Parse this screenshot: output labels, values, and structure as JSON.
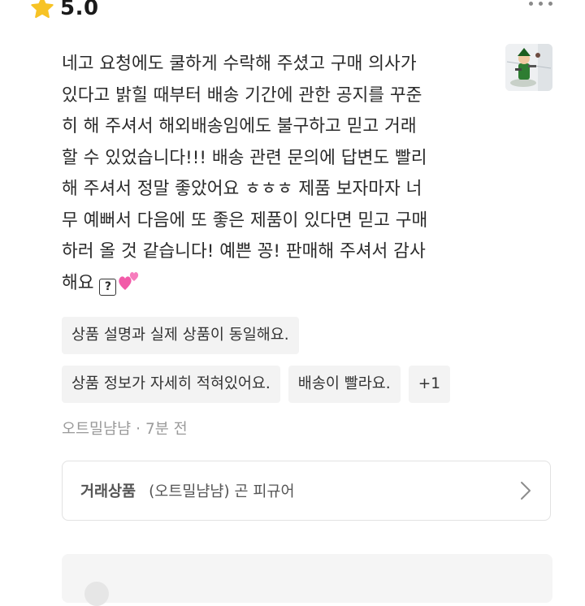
{
  "rating": {
    "value": "5.0",
    "icon": "star-icon",
    "star_color": "#F7C325"
  },
  "more_menu": {
    "icon": "more-dots-icon"
  },
  "review": {
    "lines": [
      "네고 요청에도 쿨하게 수락해 주셨고 구매 의사가",
      "있다고 밝힐 때부터 배송 기간에 관한 공지를 꾸준",
      "히 해 주셔서 해외배송임에도 불구하고 믿고 거래",
      "할 수 있었습니다!!! 배송 관련 문의에 답변도 빨리",
      "해 주셔서 정말 좋았어요 ㅎㅎㅎ 제품 보자마자 너",
      "무 예뻐서 다음에 또 좋은 제품이 있다면 믿고 구매",
      "하러 올 것 같습니다! 예쁜 꽁! 판매해 주셔서 감사"
    ],
    "last_line": "해요 ",
    "question_glyph": "?",
    "heart_icon": "two-hearts-icon",
    "heart_color": "#F25AA8"
  },
  "thumbnail": {
    "icon": "figure-photo"
  },
  "tags": {
    "row1": [
      "상품 설명과 실제 상품이 동일해요."
    ],
    "row2": [
      "상품 정보가 자세히 적혀있어요.",
      "배송이 빨라요.",
      "+1"
    ]
  },
  "meta": {
    "author": "오트밀냠냠",
    "separator": "·",
    "time": "7분 전"
  },
  "product": {
    "label": "거래상품",
    "name": "(오트밀냠냠) 곤 피규어",
    "icon": "chevron-right-icon"
  }
}
